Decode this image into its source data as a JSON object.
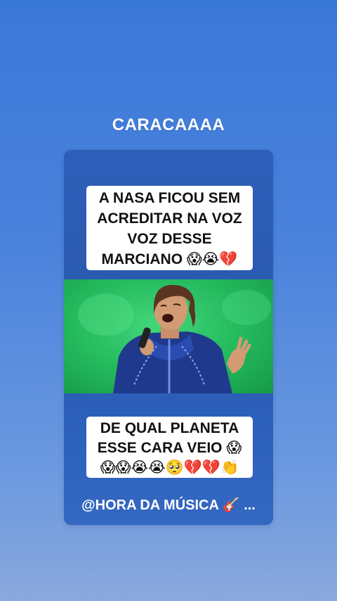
{
  "story": {
    "caption": "CARACAAAA"
  },
  "post": {
    "top_banner": {
      "lines": [
        "A NASA FICOU SEM",
        "ACREDITAR NA VOZ",
        "VOZ DESSE",
        "MARCIANO 😱😭💔"
      ]
    },
    "bottom_banner": {
      "lines": [
        "DE QUAL PLANETA",
        "ESSE CARA VEIO 😱",
        "😱😱😭😭🥺💔💔👏"
      ]
    },
    "credit": "@HORA DA MÚSICA 🎸 ...",
    "video": {
      "background_color": "#23b85c"
    }
  }
}
